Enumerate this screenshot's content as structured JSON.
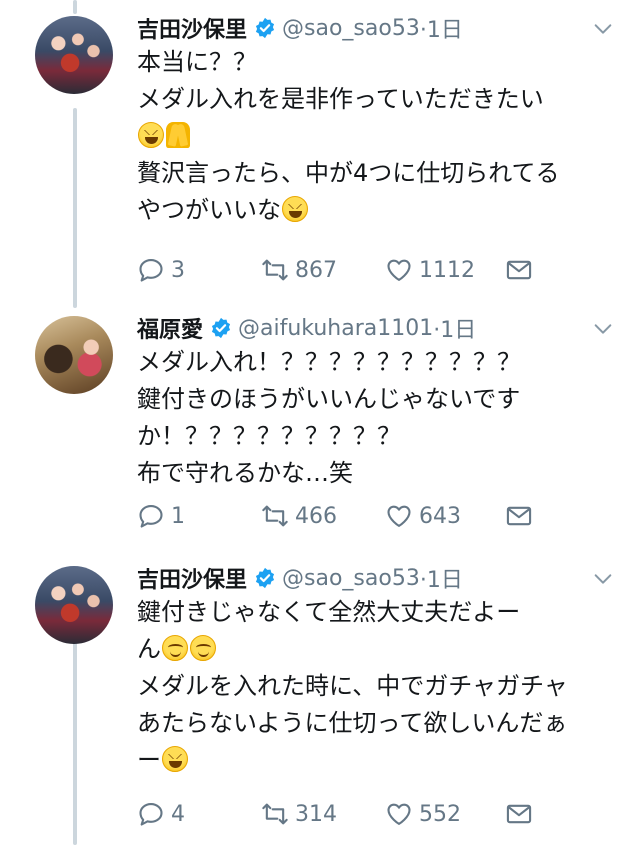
{
  "tweets": [
    {
      "name": "吉田沙保里",
      "handle": "@sao_sao53",
      "time": "·1日",
      "lines": [
        "本当に？？",
        "メダル入れを是非作っていただきたい",
        "",
        "贅沢言ったら、中が4つに仕切られてる",
        "やつがいいな"
      ],
      "emoji": {
        "line3": [
          "grin-emoji",
          "pray-emoji"
        ],
        "line5": [
          "grin-emoji"
        ]
      },
      "replies": "3",
      "retweets": "867",
      "likes": "1112"
    },
    {
      "name": "福原愛",
      "handle": "@aifukuhara1101",
      "time": "·1日",
      "lines": [
        "メダル入れ！？？？？？？？？？？",
        "鍵付きのほうがいいんじゃないです",
        "か！？？？？？？？？？",
        "布で守れるかな…笑"
      ],
      "replies": "1",
      "retweets": "466",
      "likes": "643"
    },
    {
      "name": "吉田沙保里",
      "handle": "@sao_sao53",
      "time": "·1日",
      "lines": [
        "鍵付きじゃなくて全然大丈夫だよー",
        "ん",
        "メダルを入れた時に、中でガチャガチャ",
        "あたらないように仕切って欲しいんだぁ",
        "ー"
      ],
      "emoji": {
        "line2": [
          "smile-emoji",
          "smile-emoji"
        ],
        "line5": [
          "grin-emoji"
        ]
      },
      "replies": "4",
      "retweets": "314",
      "likes": "552"
    }
  ],
  "colors": {
    "text": "#14171a",
    "secondary": "#657786",
    "verified": "#1da1f2",
    "thread": "#ccd6dd"
  },
  "icons": [
    "verified-badge-icon",
    "chevron-down-icon",
    "reply-icon",
    "retweet-icon",
    "like-heart-icon",
    "direct-message-icon"
  ]
}
